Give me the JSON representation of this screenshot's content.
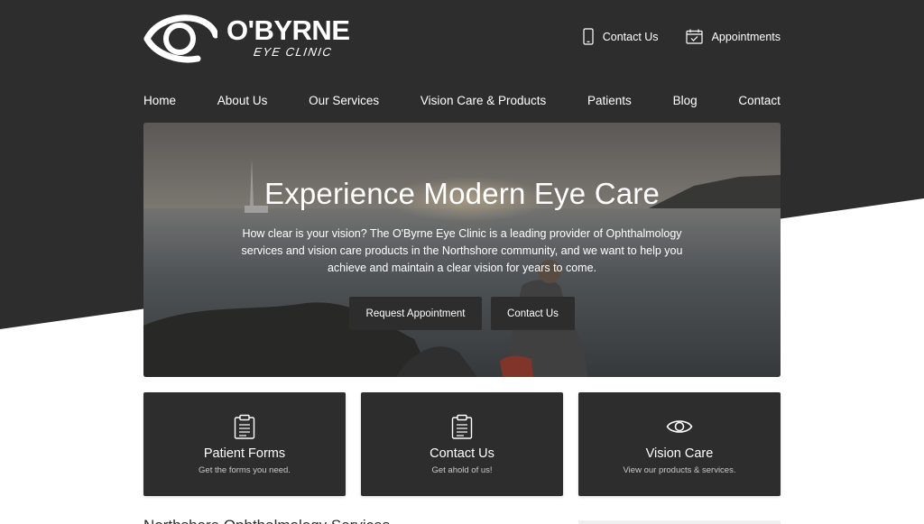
{
  "logo": {
    "name": "O'BYRNE",
    "sub": "EYE CLINIC"
  },
  "utility": {
    "contact_label": "Contact Us",
    "appointments_label": "Appointments"
  },
  "nav": {
    "items": [
      "Home",
      "About Us",
      "Our Services",
      "Vision Care & Products",
      "Patients",
      "Blog",
      "Contact"
    ]
  },
  "hero": {
    "title": "Experience Modern Eye Care",
    "text": "How clear is your vision? The O'Byrne Eye Clinic is a leading provider of Ophthalmology services and vision care products in the Northshore community, and we want to help you achieve and maintain a clear vision for years to come.",
    "request_label": "Request Appointment",
    "contact_label": "Contact Us"
  },
  "cards": [
    {
      "title": "Patient Forms",
      "sub": "Get the forms you need.",
      "icon": "clipboard-icon"
    },
    {
      "title": "Contact Us",
      "sub": "Get ahold of us!",
      "icon": "clipboard-icon"
    },
    {
      "title": "Vision Care",
      "sub": "View our products & services.",
      "icon": "eye-icon"
    }
  ],
  "below": {
    "title": "Northshore Ophthalmology Services"
  },
  "colors": {
    "dark": "#2d2d2d",
    "white": "#ffffff"
  }
}
